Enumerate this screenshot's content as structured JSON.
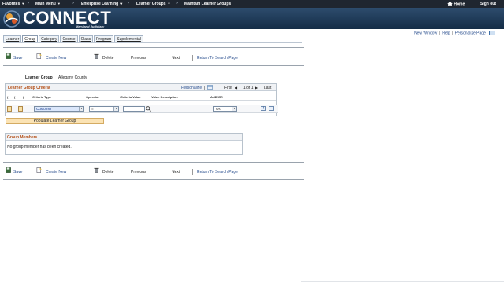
{
  "topnav": {
    "favorites": "Favorites",
    "main_menu": "Main Menu",
    "enterprise_learning": "Enterprise Learning",
    "learner_groups": "Learner Groups",
    "maintain_learner_groups": "Maintain Learner Groups",
    "home": "Home",
    "sign_out": "Sign out"
  },
  "banner": {
    "app_name": "CONNECT",
    "subtitle": "Maryland Judiciary"
  },
  "toplinks": {
    "new_window": "New Window",
    "help": "Help",
    "personalize_page": "Personalize Page"
  },
  "tabs": [
    {
      "label": "Learner"
    },
    {
      "label": "Group"
    },
    {
      "label": "Category"
    },
    {
      "label": "Course"
    },
    {
      "label": "Class"
    },
    {
      "label": "Program"
    },
    {
      "label": "Supplemental"
    }
  ],
  "toolbar": {
    "save": "Save",
    "create_new": "Create New",
    "delete": "Delete",
    "previous": "Previous",
    "next": "Next",
    "return_to_search": "Return To Search Page"
  },
  "learner_group": {
    "label": "Learner Group",
    "value": "Allegany County"
  },
  "criteria_grid": {
    "title": "Learner Group Criteria",
    "personalize": "Personalize",
    "first": "First",
    "range": "1 of 1",
    "last": "Last",
    "columns": {
      "col1": "(",
      "col2": "(",
      "col3": "(",
      "criteria_type": "Criteria Type",
      "operator": "Operator",
      "criteria_value": "Criteria Value",
      "value_description": "Value Description",
      "and_or": "AND/OR"
    },
    "row": {
      "criteria_type": "Customer",
      "operator": "=",
      "criteria_value": "",
      "and_or": "OR"
    },
    "add_button": "+",
    "remove_button": "−"
  },
  "populate_button": "Populate Learner Group",
  "group_members": {
    "title": "Group Members",
    "message": "No group member has been created."
  },
  "colors": {
    "topnav_bg": "#1f2630",
    "banner_bg": "#1d3957",
    "section_title": "#b5521b",
    "link": "#2a4f8f",
    "populate_bg": "#fbe3b4"
  },
  "icons": [
    "home-icon",
    "save-icon",
    "create-new-icon",
    "delete-icon",
    "personalize-icon",
    "lookup-icon",
    "new-window-icon"
  ]
}
